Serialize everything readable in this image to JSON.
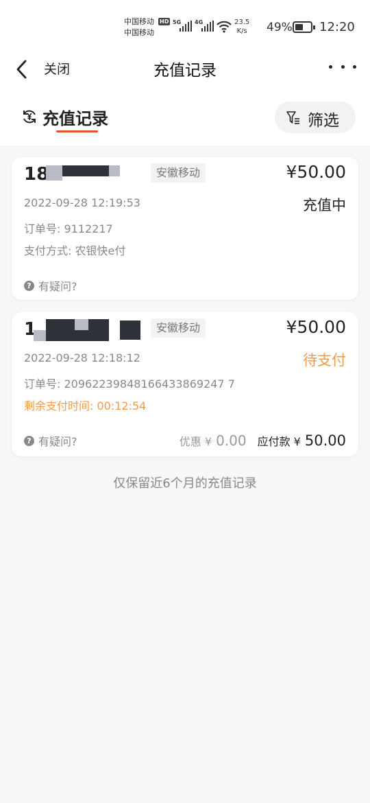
{
  "status_bar": {
    "carrier_line1": "中国移动",
    "carrier_line2": "中国移动",
    "hd_badge": "HD",
    "signal1_label": "5G",
    "signal2_label": "4G",
    "net_speed_value": "23.5",
    "net_speed_unit": "K/s",
    "battery_percent": "49%",
    "time": "12:20"
  },
  "nav": {
    "close_label": "关闭",
    "title": "充值记录",
    "back_icon": "chevron-left-icon",
    "more_icon": "more-dots-icon"
  },
  "tab": {
    "label": "充值记录",
    "icon": "yuan-refresh-icon",
    "filter_label": "筛选",
    "filter_icon": "funnel-icon",
    "accent_color": "#e0542a"
  },
  "records": [
    {
      "phone_visible": "18",
      "carrier_tag": "安徽移动",
      "amount": "¥50.00",
      "time": "2022-09-28 12:19:53",
      "status": "充值中",
      "order_no": "订单号: 9112217",
      "pay_method": "支付方式: 农银快e付",
      "help": "有疑问?"
    },
    {
      "phone_visible": "1",
      "carrier_tag": "安徽移动",
      "amount": "¥50.00",
      "time": "2022-09-28 12:18:12",
      "status": "待支付",
      "status_color": "#f29b45",
      "order_no": "订单号: 20962239848166433869247 7",
      "remaining": "剩余支付时间: 00:12:54",
      "help": "有疑问?",
      "discount_label": "优惠 ¥",
      "discount_value": "0.00",
      "due_label": "应付款 ¥",
      "due_value": "50.00"
    }
  ],
  "footer_note": "仅保留近6个月的充值记录"
}
